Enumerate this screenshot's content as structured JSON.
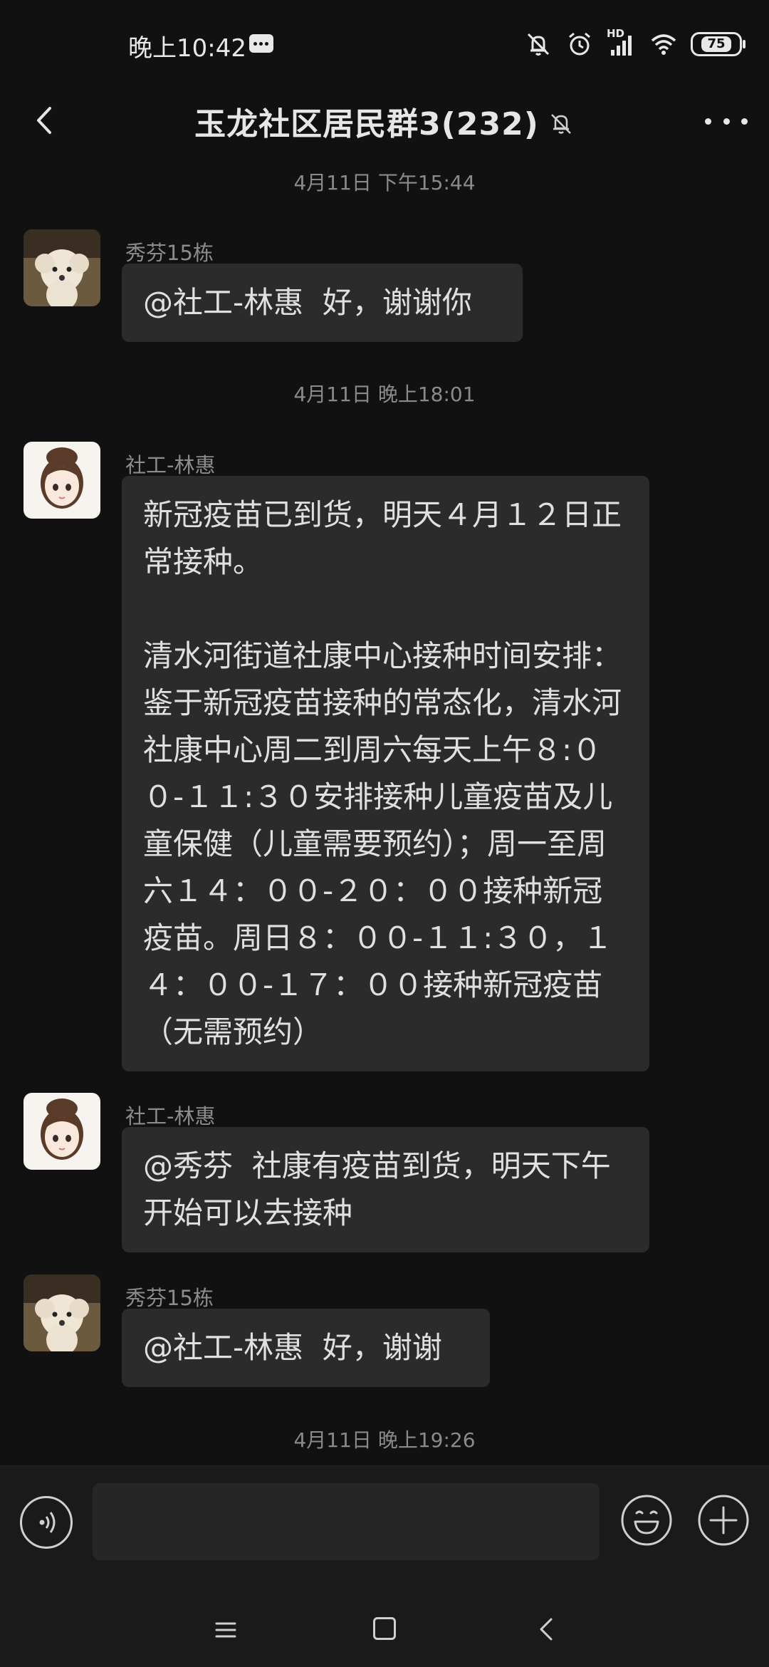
{
  "status_bar": {
    "time": "晚上10:42",
    "network_label": "HD",
    "battery": "75"
  },
  "header": {
    "title": "玉龙社区居民群3(232)"
  },
  "chat": {
    "timestamps": [
      "4月11日 下午15:44",
      "4月11日 晚上18:01",
      "4月11日 晚上19:26"
    ],
    "messages": [
      {
        "sender": "秀芬15栋",
        "text": "@社工-林惠  好，谢谢你"
      },
      {
        "sender": "社工-林惠",
        "text": "新冠疫苗已到货，明天４月１２日正常接种。\n\n清水河街道社康中心接种时间安排：\n鉴于新冠疫苗接种的常态化，清水河社康中心周二到周六每天上午８:００-１１:３０安排接种儿童疫苗及儿童保健（儿童需要预约）；周一至周六１４：００-２０：００接种新冠疫苗。周日８：００-１１:３０，１４：００-１７：００接种新冠疫苗（无需预约）"
      },
      {
        "sender": "社工-林惠",
        "text": "@秀芬  社康有疫苗到货，明天下午开始可以去接种"
      },
      {
        "sender": "秀芬15栋",
        "text": "@社工-林惠  好，谢谢"
      }
    ]
  },
  "input_bar": {
    "value": "",
    "placeholder": ""
  },
  "icons": {
    "back": "back-arrow-icon",
    "mute": "bell-muted-icon",
    "more": "more-dots-icon",
    "voice": "voice-icon",
    "emoji": "emoji-icon",
    "plus": "plus-icon"
  },
  "colors": {
    "background": "#111111",
    "bubble": "#2b2b2b",
    "text": "#e0e0e0",
    "secondary_text": "#8a8a8a"
  }
}
